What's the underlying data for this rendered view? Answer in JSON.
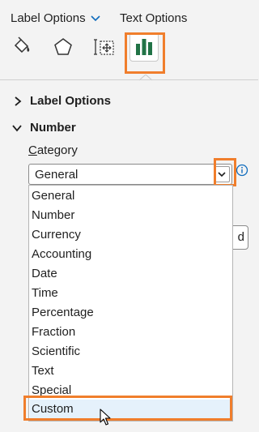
{
  "tabs": {
    "label_options": "Label Options",
    "text_options": "Text Options"
  },
  "icon_bar": {
    "icons": [
      "fill-line-icon",
      "effects-pentagon-icon",
      "size-properties-icon",
      "label-options-chart-icon"
    ],
    "selected": "label-options-chart-icon"
  },
  "sections": {
    "label_options": "Label Options",
    "number": "Number"
  },
  "category": {
    "label": "Category",
    "selected": "General",
    "options": [
      "General",
      "Number",
      "Currency",
      "Accounting",
      "Date",
      "Time",
      "Percentage",
      "Fraction",
      "Scientific",
      "Text",
      "Special",
      "Custom"
    ],
    "hovered": "Custom"
  },
  "partially_hidden_button_text": "d",
  "colors": {
    "highlight": "#f07e2c",
    "accent_blue": "#0f6cbd",
    "chart_green": "#217346"
  }
}
